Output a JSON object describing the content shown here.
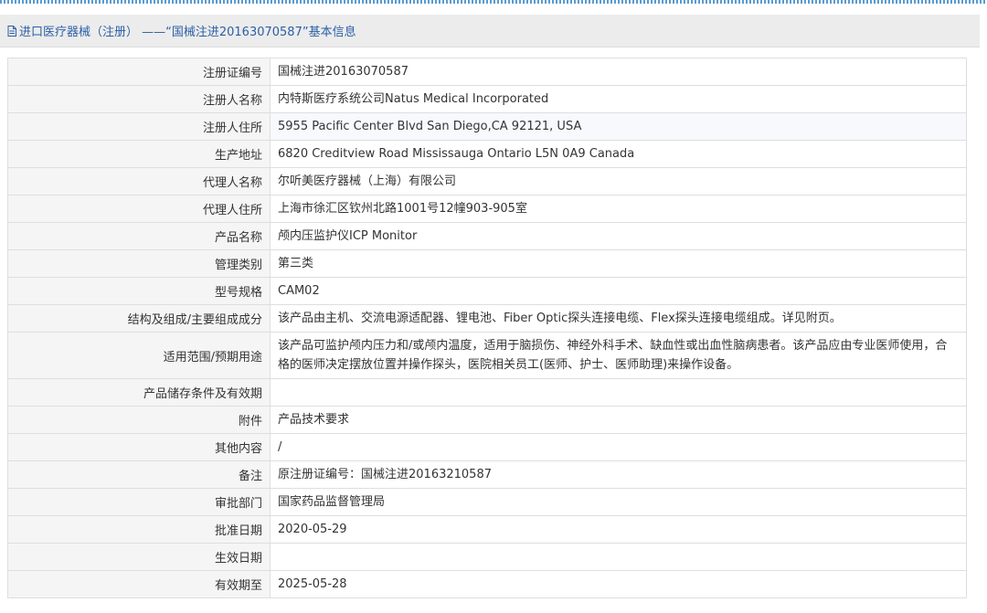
{
  "page": {
    "title": "进口医疗器械（注册） ——“国械注进20163070587”基本信息"
  },
  "rows": [
    {
      "label": "注册证编号",
      "value": "国械注进20163070587"
    },
    {
      "label": "注册人名称",
      "value": "内特斯医疗系统公司Natus Medical Incorporated"
    },
    {
      "label": "注册人住所",
      "value": "5955 Pacific Center Blvd San Diego,CA 92121, USA"
    },
    {
      "label": "生产地址",
      "value": "6820 Creditview Road Mississauga Ontario L5N 0A9 Canada"
    },
    {
      "label": "代理人名称",
      "value": "尔听美医疗器械（上海）有限公司"
    },
    {
      "label": "代理人住所",
      "value": "上海市徐汇区钦州北路1001号12幢903-905室"
    },
    {
      "label": "产品名称",
      "value": "颅内压监护仪ICP Monitor"
    },
    {
      "label": "管理类别",
      "value": "第三类"
    },
    {
      "label": "型号规格",
      "value": "CAM02"
    },
    {
      "label": "结构及组成/主要组成成分",
      "value": "该产品由主机、交流电源适配器、锂电池、Fiber Optic探头连接电缆、Flex探头连接电缆组成。详见附页。"
    },
    {
      "label": "适用范围/预期用途",
      "value": "该产品可监护颅内压力和/或颅内温度，适用于脑损伤、神经外科手术、缺血性或出血性脑病患者。该产品应由专业医师使用，合格的医师决定摆放位置并操作探头，医院相关员工(医师、护士、医师助理)来操作设备。"
    },
    {
      "label": "产品储存条件及有效期",
      "value": ""
    },
    {
      "label": "附件",
      "value": "产品技术要求"
    },
    {
      "label": "其他内容",
      "value": "/"
    },
    {
      "label": "备注",
      "value": "原注册证编号：国械注进20163210587"
    },
    {
      "label": "审批部门",
      "value": "国家药品监督管理局"
    },
    {
      "label": "批准日期",
      "value": "2020-05-29"
    },
    {
      "label": "生效日期",
      "value": ""
    },
    {
      "label": "有效期至",
      "value": "2025-05-28"
    }
  ]
}
